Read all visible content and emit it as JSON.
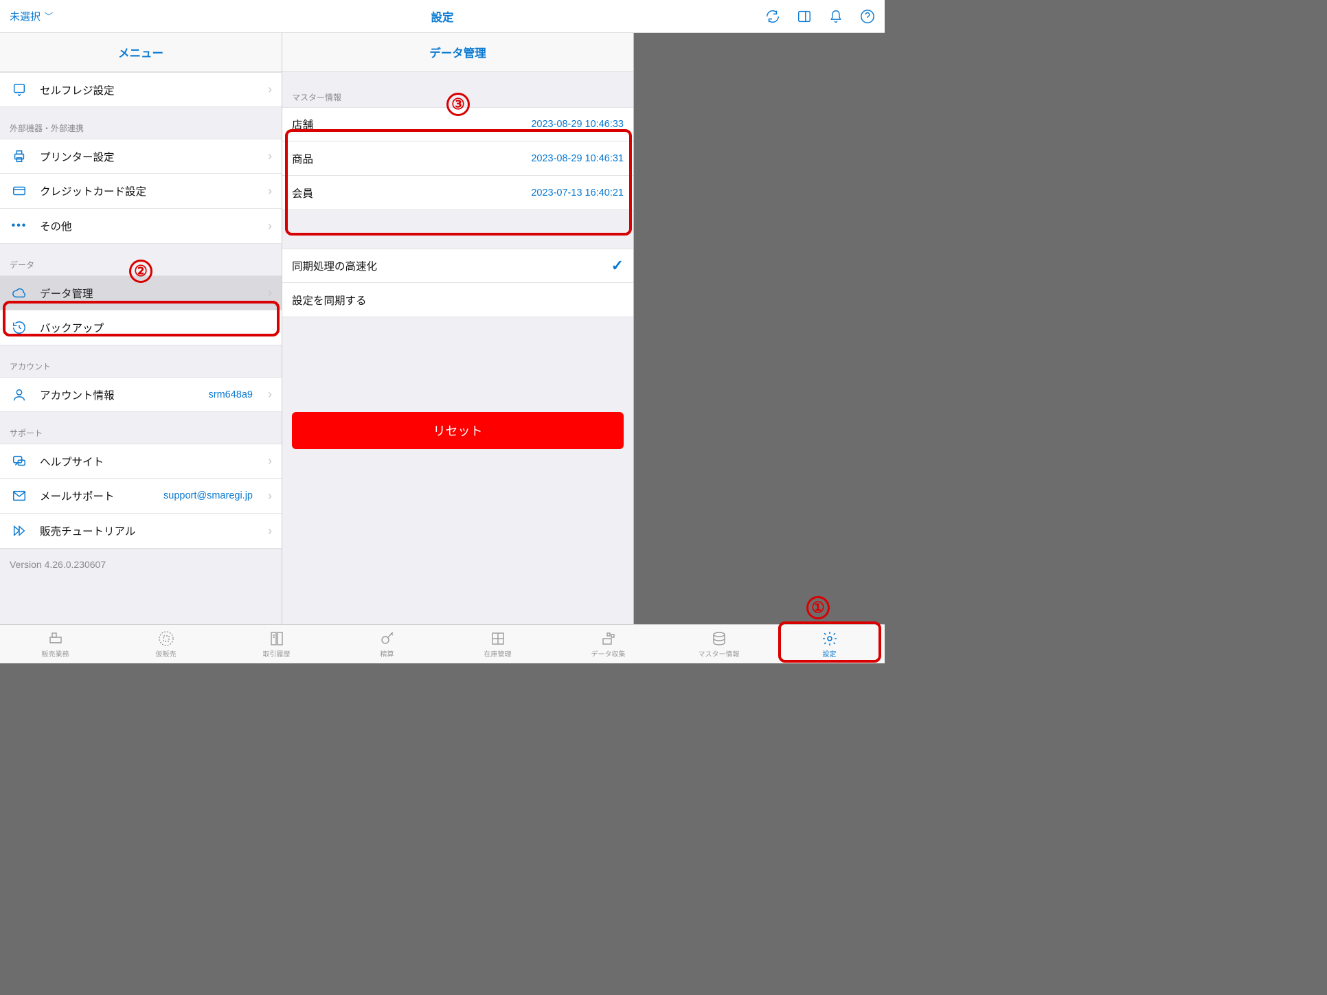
{
  "topbar": {
    "selector_label": "未選択",
    "title": "設定"
  },
  "left_panel": {
    "header": "メニュー",
    "self_register": "セルフレジ設定",
    "section_external": "外部機器・外部連携",
    "printer": "プリンター設定",
    "credit_card": "クレジットカード設定",
    "other": "その他",
    "section_data": "データ",
    "data_mgmt": "データ管理",
    "backup": "バックアップ",
    "section_account": "アカウント",
    "account_info": "アカウント情報",
    "account_value": "srm648a9",
    "section_support": "サポート",
    "help_site": "ヘルプサイト",
    "mail_support": "メールサポート",
    "mail_value": "support@smaregi.jp",
    "sales_tutorial": "販売チュートリアル",
    "version": "Version 4.26.0.230607"
  },
  "mid_panel": {
    "header": "データ管理",
    "section_master": "マスター情報",
    "store_label": "店舗",
    "store_time": "2023-08-29 10:46:33",
    "product_label": "商品",
    "product_time": "2023-08-29 10:46:31",
    "member_label": "会員",
    "member_time": "2023-07-13 16:40:21",
    "sync_speed": "同期処理の高速化",
    "sync_settings": "設定を同期する",
    "reset": "リセット"
  },
  "tabs": {
    "t1": "販売業務",
    "t2": "仮販売",
    "t3": "取引履歴",
    "t4": "精算",
    "t5": "在庫管理",
    "t6": "データ収集",
    "t7": "マスター情報",
    "t8": "設定"
  },
  "annotations": {
    "a1": "①",
    "a2": "②",
    "a3": "③"
  }
}
